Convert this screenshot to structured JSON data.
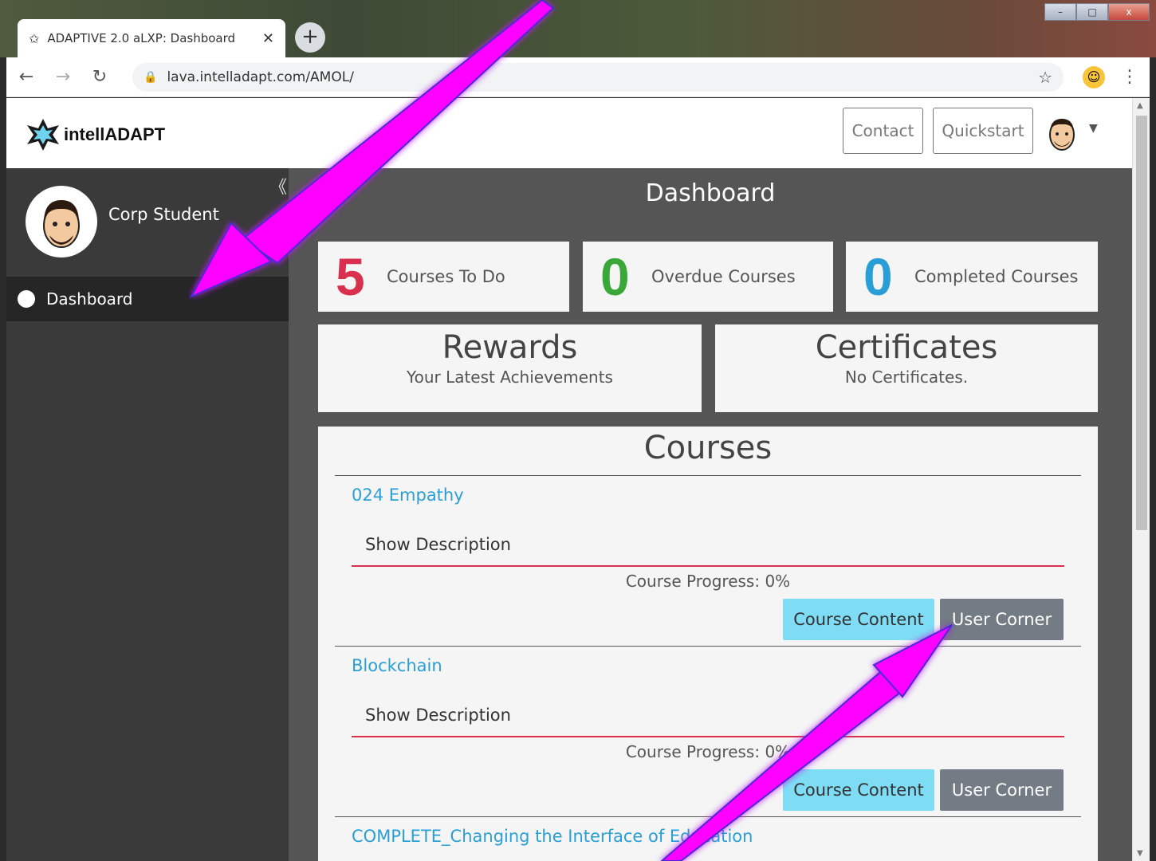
{
  "browser": {
    "tab_title": "ADAPTIVE 2.0 aLXP: Dashboard",
    "tab_close": "✕",
    "new_tab": "+",
    "url": "lava.intelladapt.com/AMOL/",
    "window_controls": {
      "minimize": "–",
      "maximize": "□",
      "close": "x"
    }
  },
  "header": {
    "logo_text": "intellADAPT",
    "contact_label": "Contact",
    "quickstart_label": "Quickstart"
  },
  "sidebar": {
    "user_name": "Corp Student",
    "collapse": "《",
    "items": [
      {
        "label": "Dashboard"
      }
    ]
  },
  "main": {
    "title": "Dashboard",
    "stats": [
      {
        "value": "5",
        "label": "Courses To Do",
        "color": "#d9304f"
      },
      {
        "value": "0",
        "label": "Overdue Courses",
        "color": "#3aa838"
      },
      {
        "value": "0",
        "label": "Completed Courses",
        "color": "#2a9fd6"
      }
    ],
    "rewards": {
      "title": "Rewards",
      "subtitle": "Your Latest Achievements"
    },
    "certificates": {
      "title": "Certificates",
      "subtitle": "No Certificates."
    },
    "courses_title": "Courses",
    "courses": [
      {
        "name": "024 Empathy",
        "show_description": "Show Description",
        "progress": "Course Progress: 0%",
        "content_btn": "Course Content",
        "corner_btn": "User Corner"
      },
      {
        "name": "Blockchain",
        "show_description": "Show Description",
        "progress": "Course Progress: 0%",
        "content_btn": "Course Content",
        "corner_btn": "User Corner"
      },
      {
        "name": "COMPLETE_Changing the Interface of Education"
      }
    ]
  },
  "colors": {
    "accent_arrow": "#ff00ff",
    "link": "#2a9fd6",
    "sidebar_bg": "#3a3a3a"
  }
}
